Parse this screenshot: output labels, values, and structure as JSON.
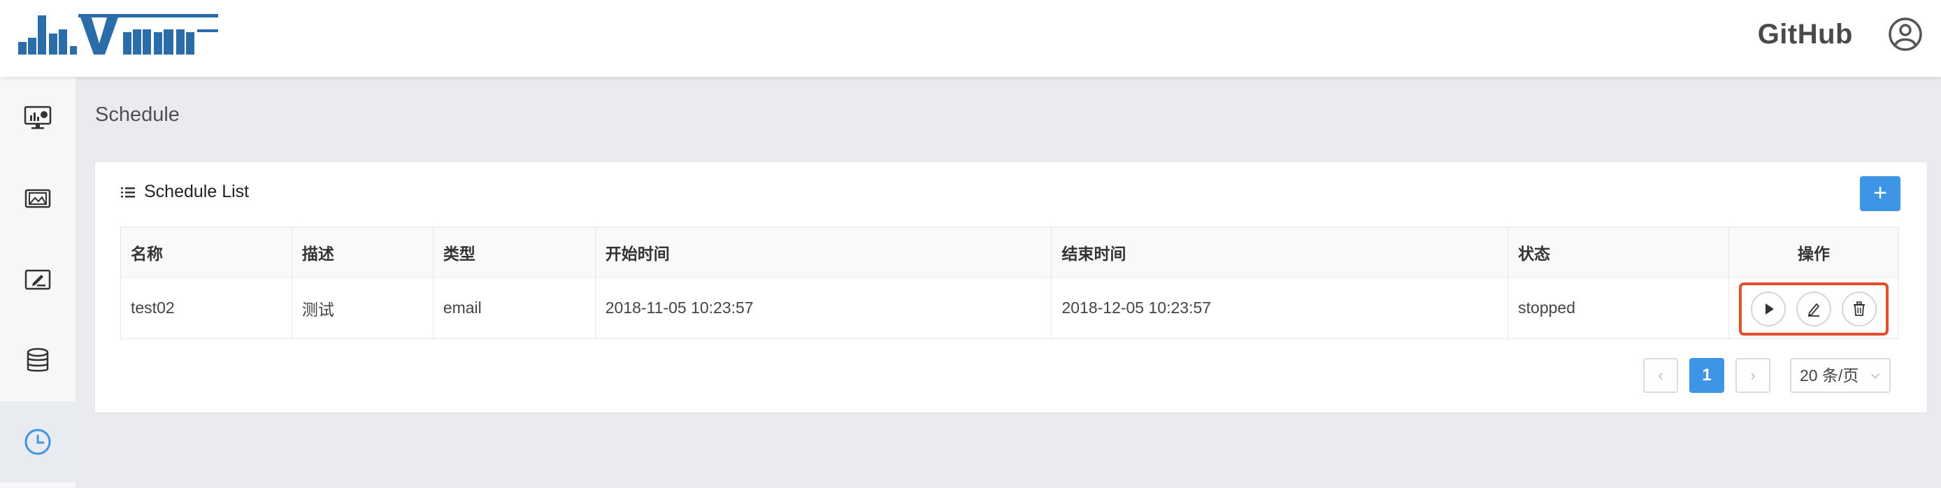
{
  "header": {
    "logo_text": "davinci",
    "github_label": "GitHub",
    "user_icon": "user-circle-icon"
  },
  "sidebar": {
    "items": [
      {
        "icon": "dashboard-monitor-icon",
        "active": false
      },
      {
        "icon": "widget-picture-icon",
        "active": false
      },
      {
        "icon": "view-edit-icon",
        "active": false
      },
      {
        "icon": "database-icon",
        "active": false
      },
      {
        "icon": "clock-icon",
        "active": true
      }
    ]
  },
  "page": {
    "title": "Schedule"
  },
  "card": {
    "title": "Schedule List",
    "title_icon": "list-icon",
    "add_button": "+"
  },
  "table": {
    "columns": [
      "名称",
      "描述",
      "类型",
      "开始时间",
      "结束时间",
      "状态",
      "操作"
    ],
    "rows": [
      {
        "name": "test02",
        "description": "测试",
        "type": "email",
        "start_time": "2018-11-05 10:23:57",
        "end_time": "2018-12-05 10:23:57",
        "status": "stopped",
        "actions": [
          "play-icon",
          "edit-icon",
          "delete-icon"
        ]
      }
    ]
  },
  "pagination": {
    "prev": "‹",
    "current_page": "1",
    "next": "›",
    "page_size": "20 条/页",
    "caret": "⌵"
  },
  "colors": {
    "accent": "#3e95e5",
    "highlight": "#e0502d",
    "logo_blue": "#2b6da8"
  }
}
